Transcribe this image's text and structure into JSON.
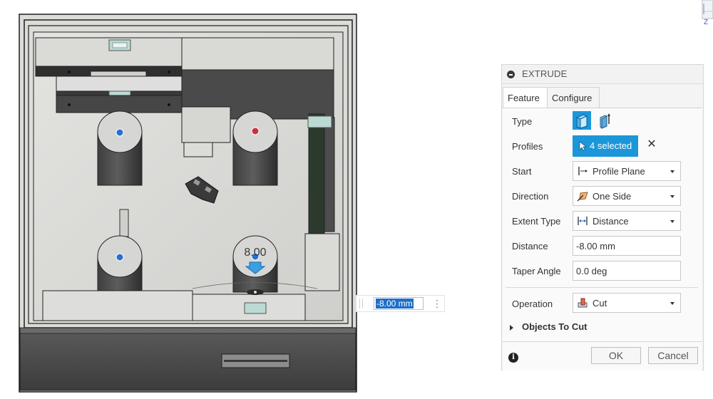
{
  "viewport": {
    "dimension_label": "8.00",
    "distance_input_value": "-8.00 mm",
    "more_menu_glyph": "⋮",
    "nav_cube_axis": "Z"
  },
  "dialog": {
    "title": "EXTRUDE",
    "tabs": [
      {
        "label": "Feature",
        "active": true
      },
      {
        "label": "Configure",
        "active": false
      }
    ],
    "rows": {
      "type": {
        "label": "Type",
        "options": [
          "solid-extrude-icon",
          "thin-extrude-icon"
        ],
        "selected": 0
      },
      "profiles": {
        "label": "Profiles",
        "value": "4 selected"
      },
      "start": {
        "label": "Start",
        "value": "Profile Plane",
        "icon": "profile-plane-icon"
      },
      "direction": {
        "label": "Direction",
        "value": "One Side",
        "icon": "one-side-icon"
      },
      "extent_type": {
        "label": "Extent Type",
        "value": "Distance",
        "icon": "distance-icon"
      },
      "distance": {
        "label": "Distance",
        "value": "-8.00 mm"
      },
      "taper_angle": {
        "label": "Taper Angle",
        "value": "0.0 deg"
      },
      "operation": {
        "label": "Operation",
        "value": "Cut",
        "icon": "cut-icon"
      }
    },
    "objects_to_cut": "Objects To Cut",
    "ok_label": "OK",
    "cancel_label": "Cancel",
    "info_glyph": "i",
    "clear_glyph": "✕"
  },
  "colors": {
    "accent": "#1b96d8",
    "selection": "#1e6fc8",
    "cut_icon": "#e86a4a"
  }
}
